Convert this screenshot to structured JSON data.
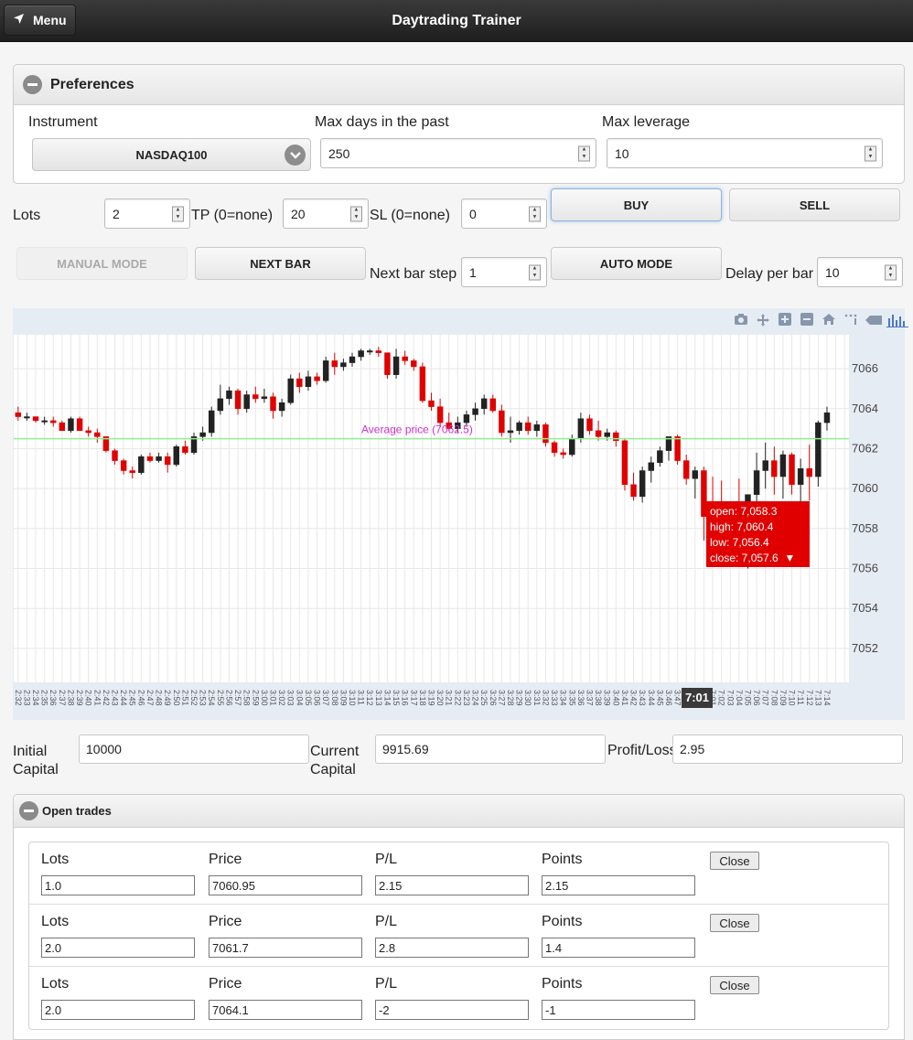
{
  "header": {
    "menu_label": "Menu",
    "title": "Daytrading Trainer"
  },
  "preferences": {
    "title": "Preferences",
    "instrument_label": "Instrument",
    "instrument_value": "NASDAQ100",
    "max_days_label": "Max days in the past",
    "max_days_value": "250",
    "max_leverage_label": "Max leverage",
    "max_leverage_value": "10"
  },
  "order": {
    "lots_label": "Lots",
    "lots_value": "2",
    "tp_label": "TP (0=none)",
    "tp_value": "20",
    "sl_label": "SL (0=none)",
    "sl_value": "0",
    "buy_label": "BUY",
    "sell_label": "SELL"
  },
  "controls": {
    "manual_mode_label": "MANUAL MODE",
    "next_bar_label": "NEXT BAR",
    "next_bar_step_label": "Next bar step",
    "next_bar_step_value": "1",
    "auto_mode_label": "AUTO MODE",
    "delay_label": "Delay per bar",
    "delay_value": "10"
  },
  "chart_data": {
    "type": "candlestick",
    "y_ticks": [
      7052,
      7054,
      7056,
      7058,
      7060,
      7062,
      7064,
      7066
    ],
    "ylim": [
      7050.3,
      7067.7
    ],
    "average_price": 7062.5,
    "average_label": "Average price (7062.5)",
    "up_color": "#222222",
    "down_color": "#e00000",
    "avg_line_color": "#90ee90",
    "avg_text_color": "#cc33cc",
    "candles": [
      [
        7063.8,
        7064.1,
        7063.4,
        7063.6
      ],
      [
        7063.6,
        7063.8,
        7063.4,
        7063.6
      ],
      [
        7063.6,
        7063.6,
        7063.3,
        7063.4
      ],
      [
        7063.4,
        7063.6,
        7063.2,
        7063.4
      ],
      [
        7063.4,
        7063.6,
        7063.1,
        7063.3
      ],
      [
        7063.3,
        7063.4,
        7062.9,
        7062.9
      ],
      [
        7062.9,
        7063.6,
        7062.8,
        7063.5
      ],
      [
        7063.5,
        7063.6,
        7062.9,
        7062.9
      ],
      [
        7062.9,
        7063.1,
        7062.6,
        7062.8
      ],
      [
        7062.8,
        7063.0,
        7062.3,
        7062.6
      ],
      [
        7062.6,
        7062.6,
        7061.8,
        7061.9
      ],
      [
        7061.9,
        7062.0,
        7061.2,
        7061.4
      ],
      [
        7061.4,
        7061.5,
        7060.7,
        7060.9
      ],
      [
        7060.9,
        7061.1,
        7060.5,
        7060.8
      ],
      [
        7060.8,
        7061.7,
        7060.7,
        7061.6
      ],
      [
        7061.6,
        7061.8,
        7061.3,
        7061.4
      ],
      [
        7061.4,
        7061.8,
        7061.3,
        7061.6
      ],
      [
        7061.6,
        7061.8,
        7060.8,
        7061.2
      ],
      [
        7061.2,
        7062.2,
        7061.1,
        7062.1
      ],
      [
        7062.1,
        7062.4,
        7061.7,
        7061.8
      ],
      [
        7061.8,
        7062.8,
        7061.7,
        7062.6
      ],
      [
        7062.6,
        7063.1,
        7062.4,
        7062.8
      ],
      [
        7062.8,
        7064.1,
        7062.6,
        7063.9
      ],
      [
        7063.9,
        7065.2,
        7063.7,
        7064.5
      ],
      [
        7064.5,
        7065.1,
        7064.2,
        7064.9
      ],
      [
        7064.9,
        7065.0,
        7063.7,
        7064.0
      ],
      [
        7064.0,
        7064.9,
        7063.8,
        7064.7
      ],
      [
        7064.7,
        7065.1,
        7064.3,
        7064.5
      ],
      [
        7064.5,
        7065.0,
        7064.3,
        7064.6
      ],
      [
        7064.6,
        7064.8,
        7063.5,
        7063.9
      ],
      [
        7063.9,
        7064.5,
        7063.6,
        7064.3
      ],
      [
        7064.3,
        7065.7,
        7064.2,
        7065.5
      ],
      [
        7065.5,
        7065.8,
        7064.8,
        7065.1
      ],
      [
        7065.1,
        7065.9,
        7064.9,
        7065.6
      ],
      [
        7065.6,
        7065.8,
        7065.2,
        7065.4
      ],
      [
        7065.4,
        7066.6,
        7065.3,
        7066.4
      ],
      [
        7066.4,
        7066.8,
        7065.7,
        7066.1
      ],
      [
        7066.1,
        7066.5,
        7065.9,
        7066.3
      ],
      [
        7066.3,
        7066.8,
        7066.1,
        7066.6
      ],
      [
        7066.6,
        7067.0,
        7066.4,
        7066.9
      ],
      [
        7066.9,
        7067.0,
        7066.7,
        7066.9
      ],
      [
        7066.9,
        7067.1,
        7066.6,
        7066.8
      ],
      [
        7066.8,
        7066.8,
        7065.5,
        7065.7
      ],
      [
        7065.7,
        7067.0,
        7065.5,
        7066.6
      ],
      [
        7066.6,
        7066.9,
        7066.2,
        7066.4
      ],
      [
        7066.4,
        7066.5,
        7065.9,
        7066.1
      ],
      [
        7066.1,
        7066.3,
        7064.3,
        7064.4
      ],
      [
        7064.4,
        7064.8,
        7063.9,
        7064.1
      ],
      [
        7064.1,
        7064.5,
        7063.1,
        7063.3
      ],
      [
        7063.3,
        7063.8,
        7062.9,
        7063.0
      ],
      [
        7063.0,
        7063.6,
        7062.8,
        7063.3
      ],
      [
        7063.3,
        7063.9,
        7063.1,
        7063.7
      ],
      [
        7063.7,
        7064.3,
        7063.4,
        7064.0
      ],
      [
        7064.0,
        7064.7,
        7063.7,
        7064.5
      ],
      [
        7064.5,
        7064.7,
        7063.8,
        7063.9
      ],
      [
        7063.9,
        7064.2,
        7062.6,
        7062.8
      ],
      [
        7062.8,
        7063.6,
        7062.3,
        7062.9
      ],
      [
        7062.9,
        7063.4,
        7062.7,
        7063.3
      ],
      [
        7063.3,
        7063.6,
        7062.7,
        7062.9
      ],
      [
        7062.9,
        7063.4,
        7062.6,
        7063.2
      ],
      [
        7063.2,
        7063.3,
        7062.1,
        7062.3
      ],
      [
        7062.3,
        7062.4,
        7061.6,
        7061.8
      ],
      [
        7061.8,
        7062.0,
        7061.5,
        7061.7
      ],
      [
        7061.7,
        7062.7,
        7061.6,
        7062.5
      ],
      [
        7062.5,
        7063.8,
        7062.3,
        7063.5
      ],
      [
        7063.5,
        7063.7,
        7062.7,
        7062.9
      ],
      [
        7062.9,
        7063.4,
        7062.4,
        7062.6
      ],
      [
        7062.6,
        7063.0,
        7062.4,
        7062.8
      ],
      [
        7062.8,
        7062.9,
        7062.1,
        7062.4
      ],
      [
        7062.4,
        7062.5,
        7059.9,
        7060.2
      ],
      [
        7060.2,
        7060.8,
        7059.4,
        7059.6
      ],
      [
        7059.6,
        7061.1,
        7059.3,
        7060.9
      ],
      [
        7060.9,
        7061.6,
        7060.3,
        7061.3
      ],
      [
        7061.3,
        7062.1,
        7061.1,
        7061.9
      ],
      [
        7061.9,
        7062.6,
        7061.4,
        7062.6
      ],
      [
        7062.6,
        7062.7,
        7061.2,
        7061.4
      ],
      [
        7061.4,
        7061.7,
        7060.2,
        7060.5
      ],
      [
        7060.5,
        7061.1,
        7059.5,
        7060.9
      ],
      [
        7060.9,
        7061.1,
        7057.4,
        7058.6
      ],
      [
        7058.6,
        7060.6,
        7056.5,
        7058.1
      ],
      [
        7058.3,
        7060.4,
        7056.4,
        7057.6
      ],
      [
        7057.6,
        7059.2,
        7056.2,
        7058.9
      ],
      [
        7058.9,
        7060.5,
        7056.9,
        7057.8
      ],
      [
        7057.8,
        7059.4,
        7056.0,
        7059.7
      ],
      [
        7059.7,
        7061.8,
        7058.4,
        7060.9
      ],
      [
        7060.9,
        7062.3,
        7060.0,
        7061.4
      ],
      [
        7061.4,
        7062.1,
        7059.7,
        7060.6
      ],
      [
        7060.6,
        7061.9,
        7059.5,
        7061.7
      ],
      [
        7061.7,
        7061.8,
        7059.7,
        7060.2
      ],
      [
        7060.2,
        7061.5,
        7059.1,
        7061.0
      ],
      [
        7061.0,
        7062.2,
        7059.4,
        7060.6
      ],
      [
        7060.6,
        7063.4,
        7060.1,
        7063.3
      ],
      [
        7063.3,
        7064.1,
        7062.9,
        7063.8
      ]
    ],
    "x_tick_labels": [
      "2:32",
      "2:33",
      "2:34",
      "2:35",
      "2:36",
      "2:37",
      "2:38",
      "2:39",
      "2:40",
      "2:41",
      "2:42",
      "2:43",
      "2:44",
      "2:45",
      "2:46",
      "2:47",
      "2:48",
      "2:49",
      "2:50",
      "2:51",
      "2:52",
      "2:53",
      "2:54",
      "2:55",
      "2:56",
      "2:57",
      "2:58",
      "2:59",
      "3:00",
      "3:01",
      "3:02",
      "3:03",
      "3:04",
      "3:05",
      "3:06",
      "3:07",
      "3:08",
      "3:09",
      "3:10",
      "3:11",
      "3:12",
      "3:13",
      "3:14",
      "3:15",
      "3:16",
      "3:17",
      "3:18",
      "3:19",
      "3:20",
      "3:21",
      "3:22",
      "3:23",
      "3:24",
      "3:25",
      "3:26",
      "3:27",
      "3:28",
      "3:29",
      "3:30",
      "3:31",
      "3:32",
      "3:33",
      "3:34",
      "3:35",
      "3:36",
      "3:37",
      "3:38",
      "3:39",
      "3:40",
      "3:41",
      "3:42",
      "3:43",
      "3:44",
      "3:45",
      "3:46",
      "3:47",
      "3:48",
      "3:49",
      "3:50",
      "7:01",
      "7:02",
      "7:03",
      "7:04",
      "7:05",
      "7:06",
      "7:07",
      "7:08",
      "7:09",
      "7:10",
      "7:11",
      "7:12",
      "7:13",
      "7:14"
    ],
    "hover": {
      "time": "7:01",
      "open": "open: 7,058.3",
      "high": "high: 7,060.4",
      "low": "low: 7,056.4",
      "close": "close: 7,057.6"
    }
  },
  "account": {
    "initial_label_1": "Initial",
    "initial_label_2": "Capital",
    "initial_value": "10000",
    "current_label_1": "Current",
    "current_label_2": "Capital",
    "current_value": "9915.69",
    "pl_label": "Profit/Loss",
    "pl_value": "2.95"
  },
  "open_trades": {
    "title": "Open trades",
    "headers": {
      "lots": "Lots",
      "price": "Price",
      "pl": "P/L",
      "points": "Points"
    },
    "close_label": "Close",
    "rows": [
      {
        "lots": "1.0",
        "price": "7060.95",
        "pl": "2.15",
        "points": "2.15"
      },
      {
        "lots": "2.0",
        "price": "7061.7",
        "pl": "2.8",
        "points": "1.4"
      },
      {
        "lots": "2.0",
        "price": "7064.1",
        "pl": "-2",
        "points": "-1"
      }
    ]
  }
}
